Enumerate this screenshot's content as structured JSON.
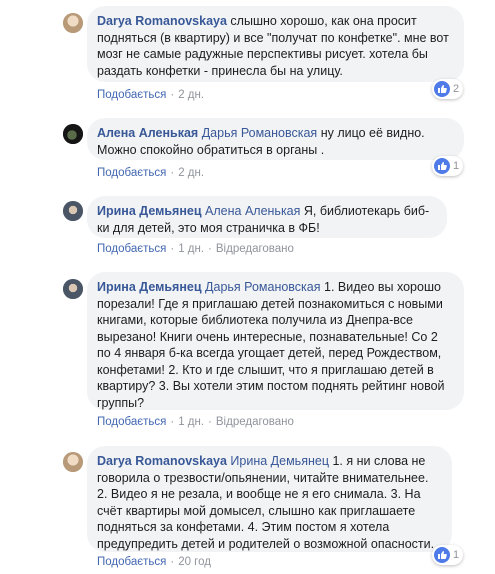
{
  "colors": {
    "link": "#385898",
    "bubble": "#f2f3f5",
    "meta": "#90949c",
    "like": "#4f7be8"
  },
  "comments": [
    {
      "author": "Darya Romanovskaya",
      "tagged": "",
      "text": "слышно хорошо, как она просит подняться (в квартиру) и все \"получат по конфетке\". мне вот мозг не самые радужные перспективы рисует. хотела бы раздать конфетки - принесла бы на улицу.",
      "like": "Подобається",
      "time": "2 дн.",
      "edited": "",
      "reactions": "2",
      "avatar_icon": "avatar-icon"
    },
    {
      "author": "Алена Аленькая",
      "tagged": "Дарья Романовская",
      "text": "ну лицо её видно. Можно спокойно обратиться в органы .",
      "like": "Подобається",
      "time": "2 дн.",
      "edited": "",
      "reactions": "1",
      "avatar_icon": "avatar-icon"
    },
    {
      "author": "Ирина Демьянец",
      "tagged": "Алена Аленькая",
      "text": "Я, библиотекарь биб-ки для детей, это моя страничка в ФБ!",
      "like": "Подобається",
      "time": "1 дн.",
      "edited": "Відредаговано",
      "reactions": "",
      "avatar_icon": "avatar-icon"
    },
    {
      "author": "Ирина Демьянец",
      "tagged": "Дарья Романовская",
      "text": "1. Видео вы хорошо порезали! Где я приглашаю детей познакомиться с новыми книгами, которые библиотека получила из Днепра-все вырезано! Книги очень интересные, познавательные! Со 2 по 4 января б-ка всегда угощает детей, перед Рождеством, конфетами! 2. Кто и где слышит, что я приглашаю детей в квартиру? 3. Вы хотели этим постом поднять рейтинг новой группы?",
      "like": "Подобається",
      "time": "1 дн.",
      "edited": "Відредаговано",
      "reactions": "",
      "avatar_icon": "avatar-icon"
    },
    {
      "author": "Darya Romanovskaya",
      "tagged": "Ирина Демьянец",
      "text": "1. я ни слова не говорила о трезвости/опьянении, читайте внимательнее. 2. Видео я не резала, и вообще не я его снимала. 3. На счёт квартиры мой домысел, слышно как приглашаете подняться за конфетами. 4. Этим постом я хотела предупредить детей и родителей о возможной опасности.",
      "like": "Подобається",
      "time": "20 год",
      "edited": "",
      "reactions": "1",
      "avatar_icon": "avatar-icon"
    }
  ]
}
